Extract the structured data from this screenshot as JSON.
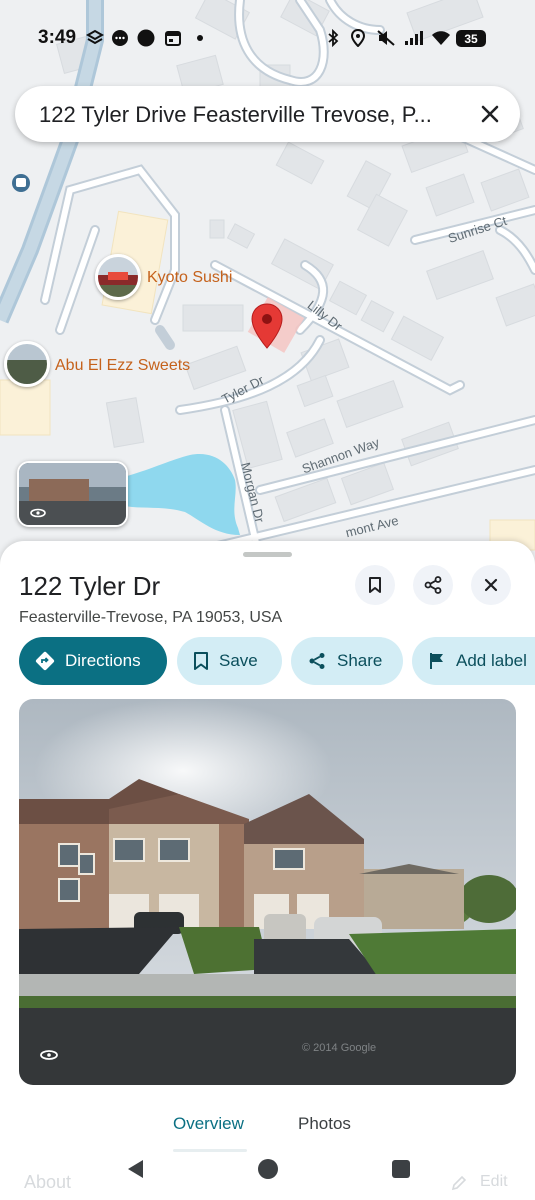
{
  "status_bar": {
    "time": "3:49",
    "battery": "35"
  },
  "search": {
    "query": "122 Tyler Drive Feasterville Trevose, P..."
  },
  "map": {
    "pois": [
      {
        "name": "Kyoto Sushi"
      },
      {
        "name": "Abu El Ezz Sweets"
      }
    ],
    "streets": {
      "sunrise": "Sunrise Ct",
      "lilly": "Lilly Dr",
      "tyler": "Tyler Dr",
      "shannon": "Shannon Way",
      "morgan": "Morgan Dr",
      "ave": "mont Ave"
    }
  },
  "place": {
    "title": "122 Tyler Dr",
    "address": "Feasterville-Trevose, PA 19053, USA"
  },
  "actions": {
    "directions": "Directions",
    "save": "Save",
    "share": "Share",
    "add_label": "Add label"
  },
  "tabs": {
    "overview": "Overview",
    "photos": "Photos"
  },
  "faded": {
    "about": "About",
    "edit": "Edit"
  },
  "watermark": "© 2014 Google",
  "colors": {
    "accent": "#0b7083",
    "chip_bg": "#d3edf5",
    "poi_label": "#c5621c",
    "pin": "#e53935",
    "water": "#8fd8ee"
  }
}
